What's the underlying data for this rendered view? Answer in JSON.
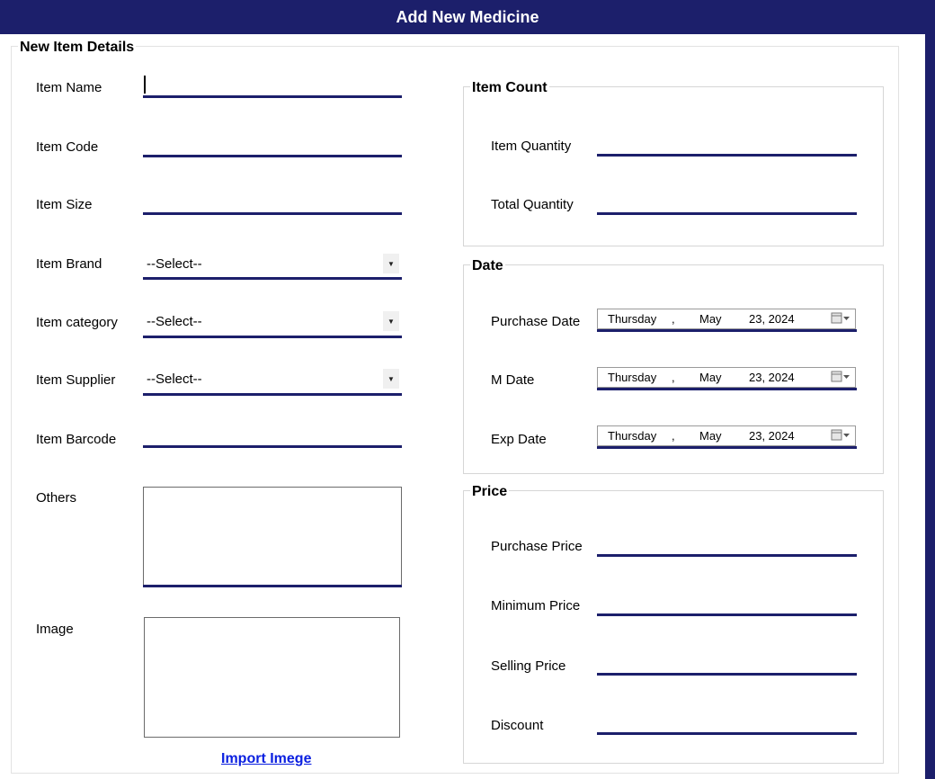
{
  "window": {
    "title": "Add New Medicine"
  },
  "details": {
    "group_title": "New Item Details",
    "item_name_label": "Item Name",
    "item_code_label": "Item Code",
    "item_size_label": "Item Size",
    "item_brand_label": "Item Brand",
    "item_brand_value": "--Select--",
    "item_category_label": "Item category",
    "item_category_value": "--Select--",
    "item_supplier_label": "Item Supplier",
    "item_supplier_value": "--Select--",
    "item_barcode_label": "Item Barcode",
    "others_label": "Others",
    "image_label": "Image",
    "import_image_link": "Import Imege"
  },
  "count": {
    "group_title": "Item Count",
    "item_quantity_label": "Item Quantity",
    "total_quantity_label": "Total Quantity"
  },
  "date": {
    "group_title": "Date",
    "purchase_date_label": "Purchase Date",
    "m_date_label": "M Date",
    "exp_date_label": "Exp Date",
    "day": "Thursday",
    "sep": ",",
    "month": "May",
    "daynum_year": "23, 2024"
  },
  "price": {
    "group_title": "Price",
    "purchase_price_label": "Purchase Price",
    "minimum_price_label": "Minimum Price",
    "selling_price_label": "Selling Price",
    "discount_label": "Discount"
  },
  "colors": {
    "accent": "#1c1f6b",
    "link": "#0b20e0"
  },
  "icons": {
    "dropdown": "chevron-down-icon",
    "calendar": "calendar-icon"
  }
}
